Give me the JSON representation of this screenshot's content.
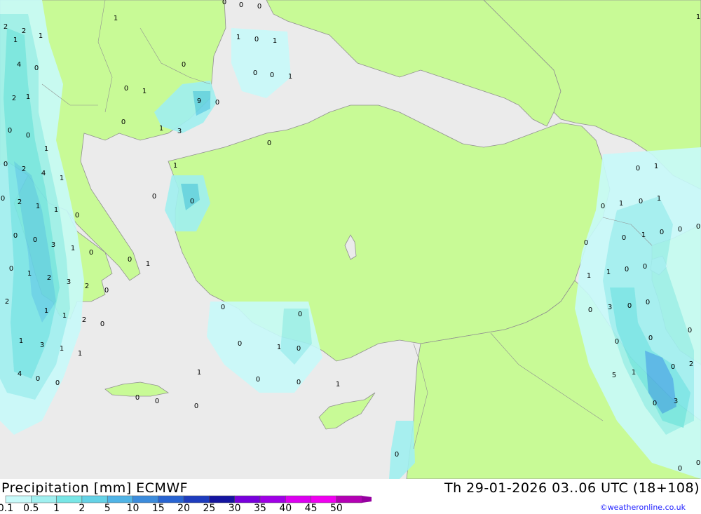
{
  "header": {
    "title": "Precipitation [mm] ECMWF",
    "valid_time": "Th 29-01-2026 03..06 UTC (18+108)",
    "credit": "©weatheronline.co.uk"
  },
  "legend": {
    "classes": [
      {
        "label": "0.1",
        "color": "#c8fafa"
      },
      {
        "label": "0.5",
        "color": "#a0f0f0"
      },
      {
        "label": "1",
        "color": "#78e6e6"
      },
      {
        "label": "2",
        "color": "#64d2e6"
      },
      {
        "label": "5",
        "color": "#50b4e6"
      },
      {
        "label": "10",
        "color": "#3c8cdc"
      },
      {
        "label": "15",
        "color": "#2864d2"
      },
      {
        "label": "20",
        "color": "#1e3cbe"
      },
      {
        "label": "25",
        "color": "#1414a0"
      },
      {
        "label": "30",
        "color": "#7800dc"
      },
      {
        "label": "35",
        "color": "#a000e6"
      },
      {
        "label": "40",
        "color": "#dc00f0"
      },
      {
        "label": "45",
        "color": "#f000f0"
      },
      {
        "label": "50",
        "color": "#b400b4"
      }
    ]
  },
  "colors": {
    "land": "#c8fa96",
    "sea": "#ebebeb",
    "coast": "#909090"
  },
  "map_values": [
    "2",
    "2",
    "1",
    "1",
    "4",
    "0",
    "2",
    "1",
    "0",
    "0",
    "2",
    "4",
    "1",
    "1",
    "2",
    "1",
    "0",
    "1",
    "0",
    "0",
    "3",
    "1",
    "0",
    "1",
    "2",
    "3",
    "2",
    "0",
    "2",
    "1",
    "1",
    "2",
    "0",
    "1",
    "1",
    "3",
    "1",
    "0",
    "0",
    "4",
    "0",
    "0",
    "0",
    "1",
    "0",
    "0",
    "0",
    "1",
    "0",
    "1",
    "0",
    "0",
    "1",
    "0",
    "0",
    "1",
    "0",
    "9",
    "0",
    "1",
    "3",
    "0",
    "1",
    "0",
    "0",
    "0",
    "1",
    "0",
    "0",
    "1",
    "0",
    "0",
    "0",
    "0",
    "1",
    "1",
    "0",
    "0",
    "0",
    "0",
    "0",
    "1",
    "0",
    "1",
    "0",
    "1",
    "0",
    "1",
    "0",
    "0",
    "0",
    "0",
    "1",
    "1",
    "0",
    "0",
    "0",
    "0",
    "3",
    "0",
    "0",
    "0",
    "1",
    "0",
    "5",
    "2",
    "0",
    "3",
    "1",
    "0",
    "0",
    "0"
  ]
}
